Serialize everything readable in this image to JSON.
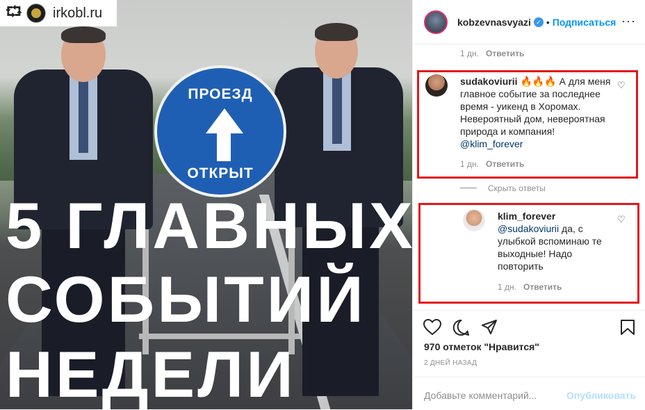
{
  "post_image": {
    "repost_icon": "repost-icon",
    "repost_account": "irkobl.ru",
    "sign_top": "ПРОЕЗД",
    "sign_bottom": "ОТКРЫТ",
    "headline_lines": [
      "5 ГЛАВНЫХ",
      "СОБЫТИЙ",
      "НЕДЕЛИ"
    ]
  },
  "header": {
    "username": "kobzevnasvyazi",
    "dot": "•",
    "follow": "Подписаться",
    "more": "···"
  },
  "comments": {
    "prev_meta": {
      "time": "1 дн.",
      "reply": "Ответить"
    },
    "first": {
      "username": "sudakoviurii",
      "text": "🔥🔥🔥 А для меня главное событие за последнее время - уикенд в Хоромах. Невероятный дом, невероятная природа и компания!",
      "mention": "@klim_forever",
      "time": "1 дн.",
      "reply": "Ответить"
    },
    "hide_replies": "Скрыть ответы",
    "reply": {
      "username": "klim_forever",
      "mention": "@sudakoviurii",
      "text": "да, с улыбкой вспоминаю те выходные! Надо повторить",
      "time": "1 дн.",
      "reply": "Ответить"
    }
  },
  "actions": {
    "likes": "970 отметок \"Нравится\"",
    "date": "2 ДНЕЙ НАЗАД"
  },
  "add_comment": {
    "placeholder": "Добавьте комментарий...",
    "publish": "Опубликовать"
  },
  "colors": {
    "highlight_box": "#e3171a",
    "link": "#0095f6"
  }
}
